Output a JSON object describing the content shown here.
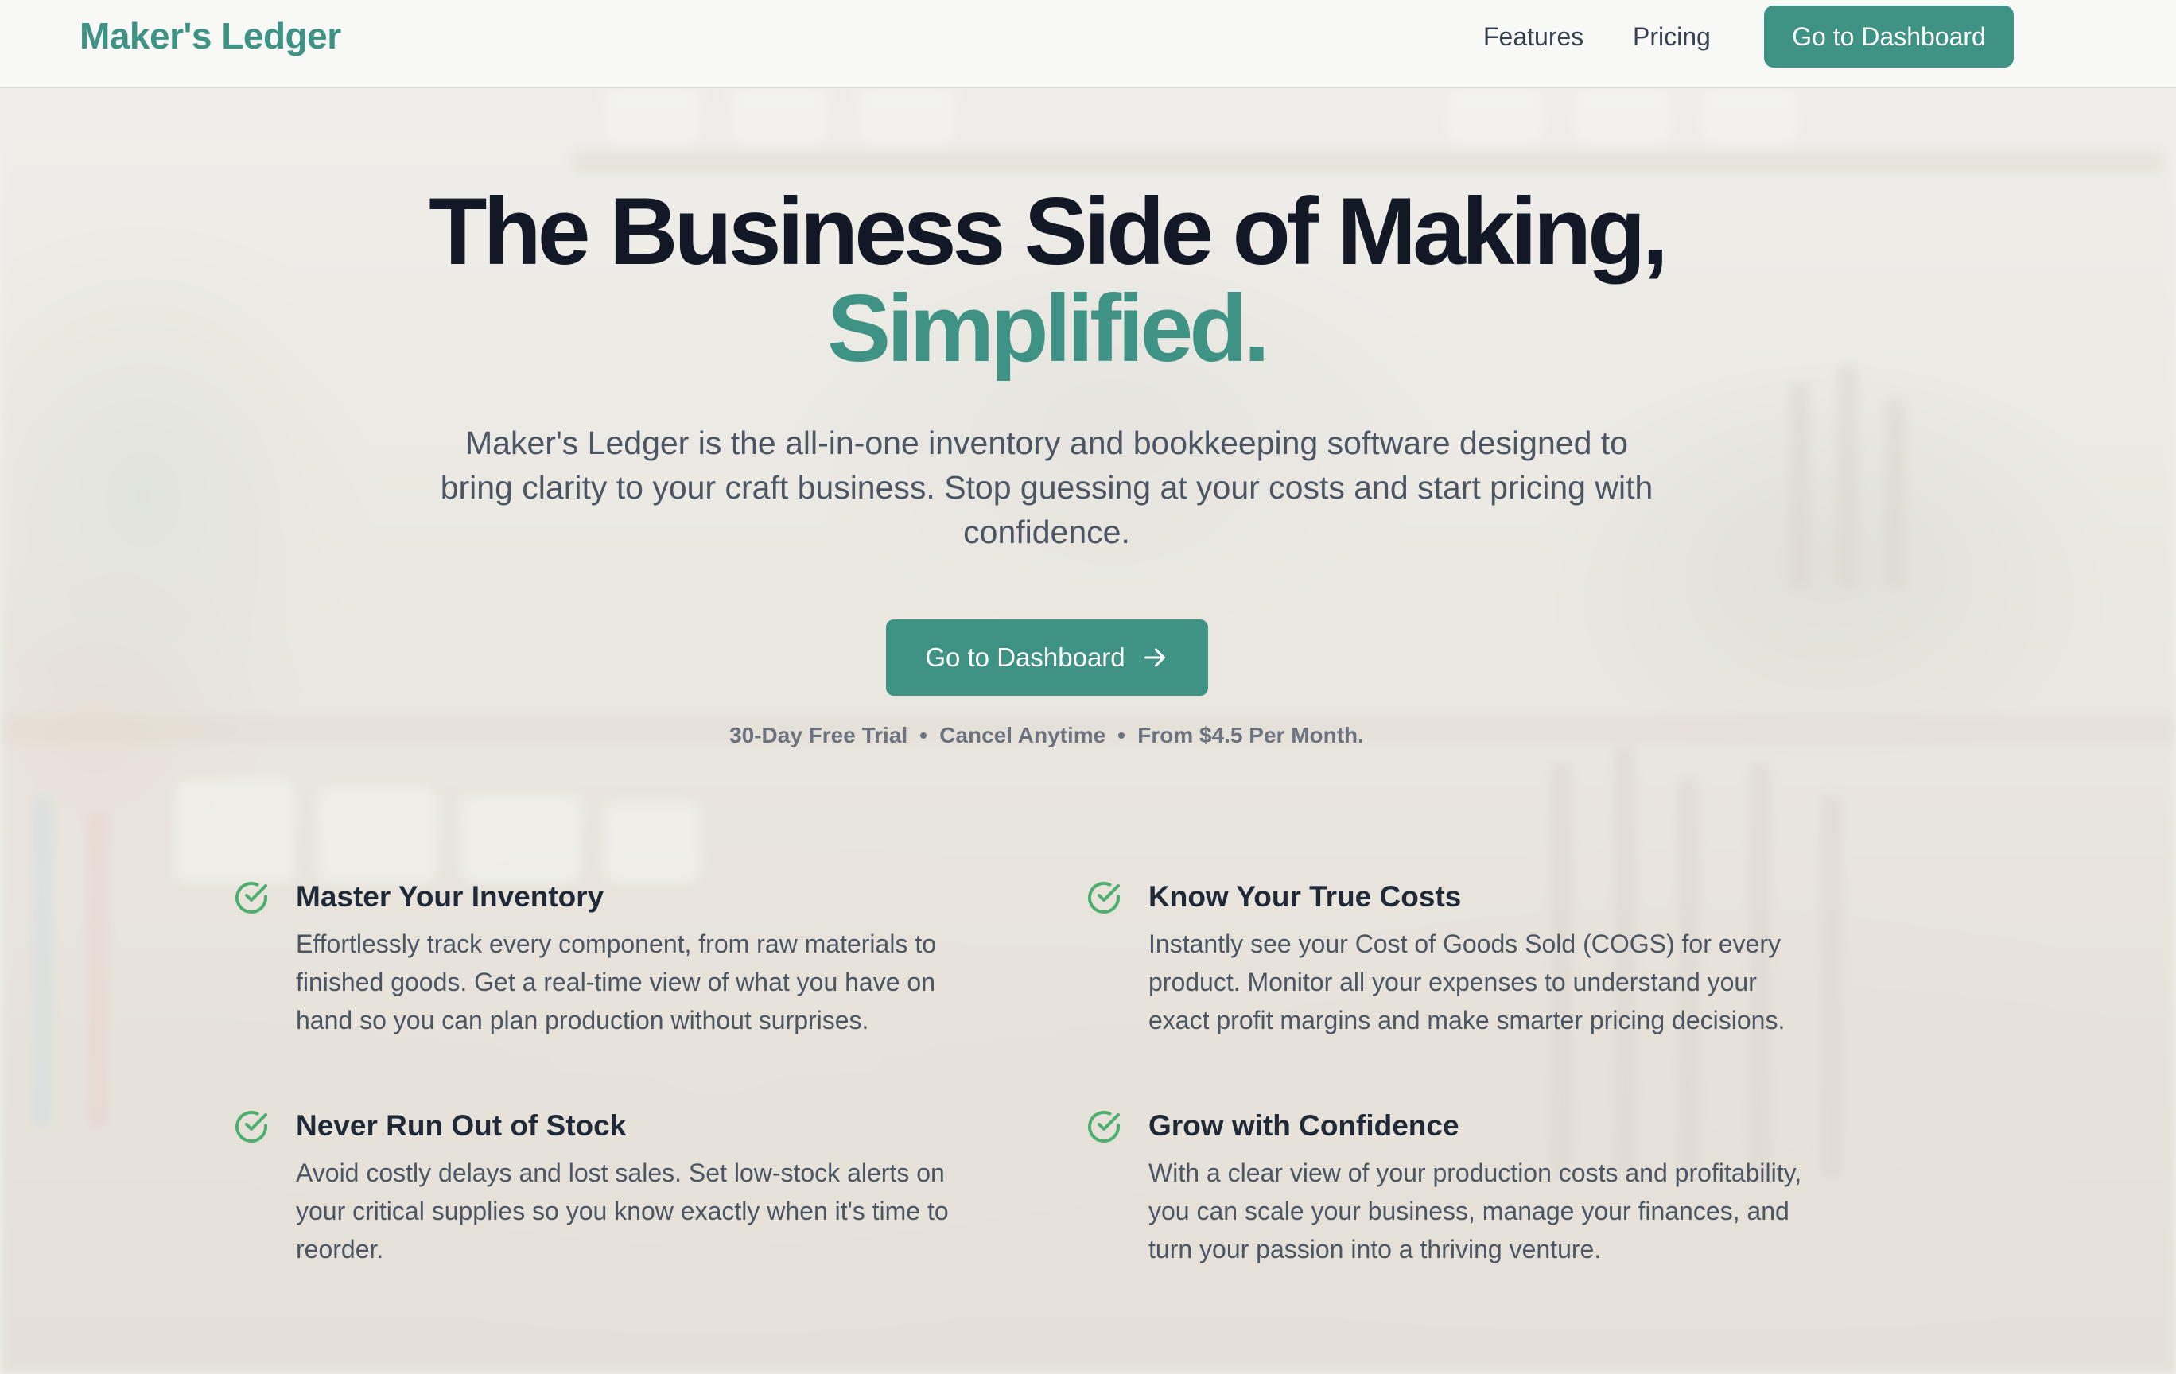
{
  "brand": {
    "name": "Maker's Ledger",
    "accent_color": "#3e9385"
  },
  "nav": {
    "features": "Features",
    "pricing": "Pricing",
    "cta": "Go to Dashboard"
  },
  "hero": {
    "title_line1": "The Business Side of Making,",
    "title_line2": "Simplified.",
    "subtitle": "Maker's Ledger is the all-in-one inventory and bookkeeping software designed to bring clarity to your craft business. Stop guessing at your costs and start pricing with confidence.",
    "cta": "Go to Dashboard",
    "cta_icon": "arrow-right-icon",
    "perks": [
      "30-Day Free Trial",
      "Cancel Anytime",
      "From $4.5 Per Month."
    ]
  },
  "features": [
    {
      "icon": "check-circle-icon",
      "title": "Master Your Inventory",
      "text": "Effortlessly track every component, from raw materials to finished goods. Get a real-time view of what you have on hand so you can plan production without surprises."
    },
    {
      "icon": "check-circle-icon",
      "title": "Know Your True Costs",
      "text": "Instantly see your Cost of Goods Sold (COGS) for every product. Monitor all your expenses to understand your exact profit margins and make smarter pricing decisions."
    },
    {
      "icon": "check-circle-icon",
      "title": "Never Run Out of Stock",
      "text": "Avoid costly delays and lost sales. Set low-stock alerts on your critical supplies so you know exactly when it's time to reorder."
    },
    {
      "icon": "check-circle-icon",
      "title": "Grow with Confidence",
      "text": "With a clear view of your production costs and profitability, you can scale your business, manage your finances, and turn your passion into a thriving venture."
    }
  ]
}
